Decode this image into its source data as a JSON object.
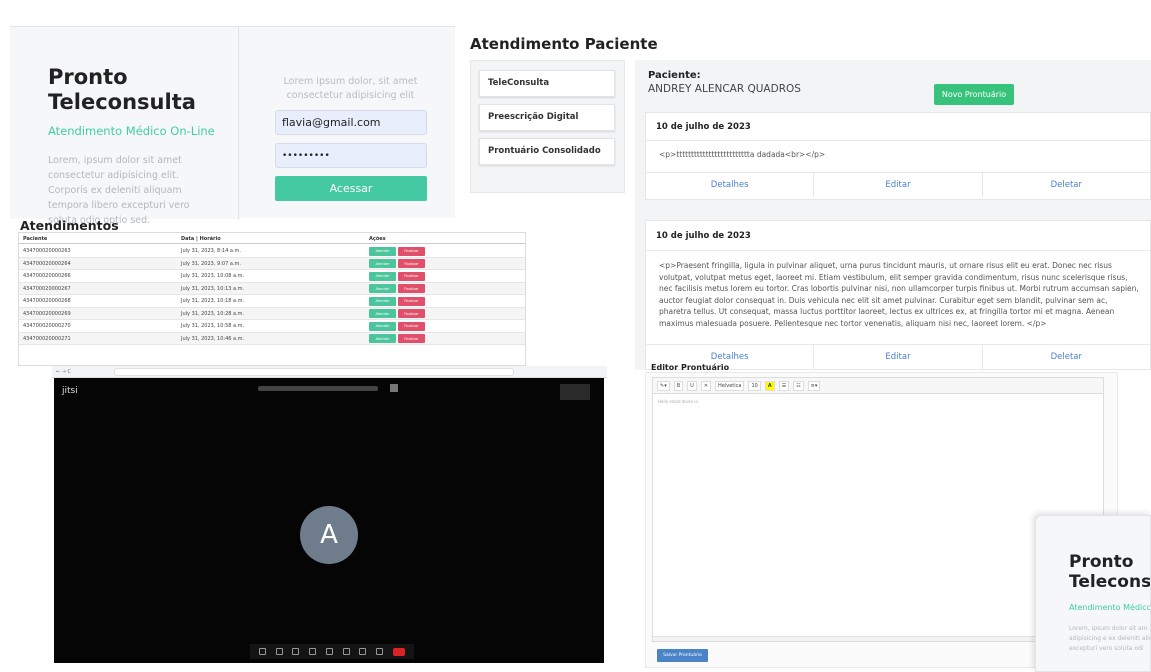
{
  "login": {
    "title": "Pronto Teleconsulta",
    "subtitle": "Atendimento Médico On-Line",
    "body": "Lorem, ipsum dolor sit amet consectetur adipisicing elit. Corporis ex deleniti aliquam tempora libero excepturi vero soluta odio optio sed.",
    "right_text": "Lorem ipsum dolor, sit amet consectetur adipisicing elit",
    "email_value": "flavia@gmail.com",
    "password_value": "•••••••••",
    "submit_label": "Acessar"
  },
  "atendimentos": {
    "title": "Atendimentos",
    "headers": [
      "Paciente",
      "Data | Horário",
      "Ações"
    ],
    "rows": [
      {
        "paciente": "434700020000263",
        "data": "July 31, 2023, 8:14 a.m."
      },
      {
        "paciente": "434700020000264",
        "data": "July 31, 2023, 9:07 a.m."
      },
      {
        "paciente": "434700020000266",
        "data": "July 31, 2023, 10:08 a.m."
      },
      {
        "paciente": "434700020000267",
        "data": "July 31, 2023, 10:13 a.m."
      },
      {
        "paciente": "434700020000268",
        "data": "July 31, 2023, 10:18 a.m."
      },
      {
        "paciente": "434700020000269",
        "data": "July 31, 2023, 10:28 a.m."
      },
      {
        "paciente": "434700020000270",
        "data": "July 31, 2023, 10:58 a.m."
      },
      {
        "paciente": "434700020000271",
        "data": "July 31, 2023, 10:46 a.m."
      }
    ],
    "action_attend": "Atender",
    "action_finish": "Finalizar"
  },
  "jitsi": {
    "brand": "jitsi",
    "avatar_letter": "A"
  },
  "atendimento_paciente": {
    "title": "Atendimento Paciente",
    "nav": [
      "TeleConsulta",
      "Preescrição Digital",
      "Prontuário Consolidado"
    ],
    "patient_label": "Paciente:",
    "patient_name": "ANDREY ALENCAR QUADROS",
    "new_record_label": "Novo Prontuário",
    "records": [
      {
        "date": "10 de julho de 2023",
        "content": "<p>ttttttttttttttttttttttttta dadada<br></p>"
      },
      {
        "date": "10 de julho de 2023",
        "content": "<p>Praesent fringilla, ligula in pulvinar aliquet, urna purus tincidunt mauris, ut ornare risus elit eu erat. Donec nec risus volutpat, volutpat metus eget, laoreet mi. Etiam vestibulum, elit semper gravida condimentum, risus nunc scelerisque risus, nec facilisis metus lorem eu tortor. Cras lobortis pulvinar nisi, non ullamcorper turpis finibus ut. Morbi rutrum accumsan sapien, auctor feugiat dolor consequat in. Duis vehicula nec elit sit amet pulvinar. Curabitur eget sem blandit, pulvinar sem ac, pharetra tellus. Ut consequat, massa luctus porttitor laoreet, lectus ex ultrices ex, at fringilla tortor mi et magna. Aenean maximus malesuada posuere. Pellentesque nec tortor venenatis, aliquam nisi nec, laoreet lorem. </p>"
      }
    ],
    "actions": {
      "details": "Detalhes",
      "edit": "Editar",
      "delete": "Deletar"
    }
  },
  "editor": {
    "title": "Editor Prontuário",
    "font_family": "Helvetica",
    "font_size": "10",
    "placeholder": "Hello stand alone ui",
    "save_label": "Salvar Prontuário"
  },
  "login_preview": {
    "title": "Pronto Teleconsu",
    "subtitle": "Atendimento Médico",
    "body": "Lorem, ipsum dolor sit am consectetur adipisicing e ex deleniti aliquam tempo excepturi vero soluta odi"
  },
  "colors": {
    "accent_teal": "#45c9a2",
    "green": "#38c37c",
    "red": "#e0506b",
    "link_blue": "#4a7fd0"
  }
}
